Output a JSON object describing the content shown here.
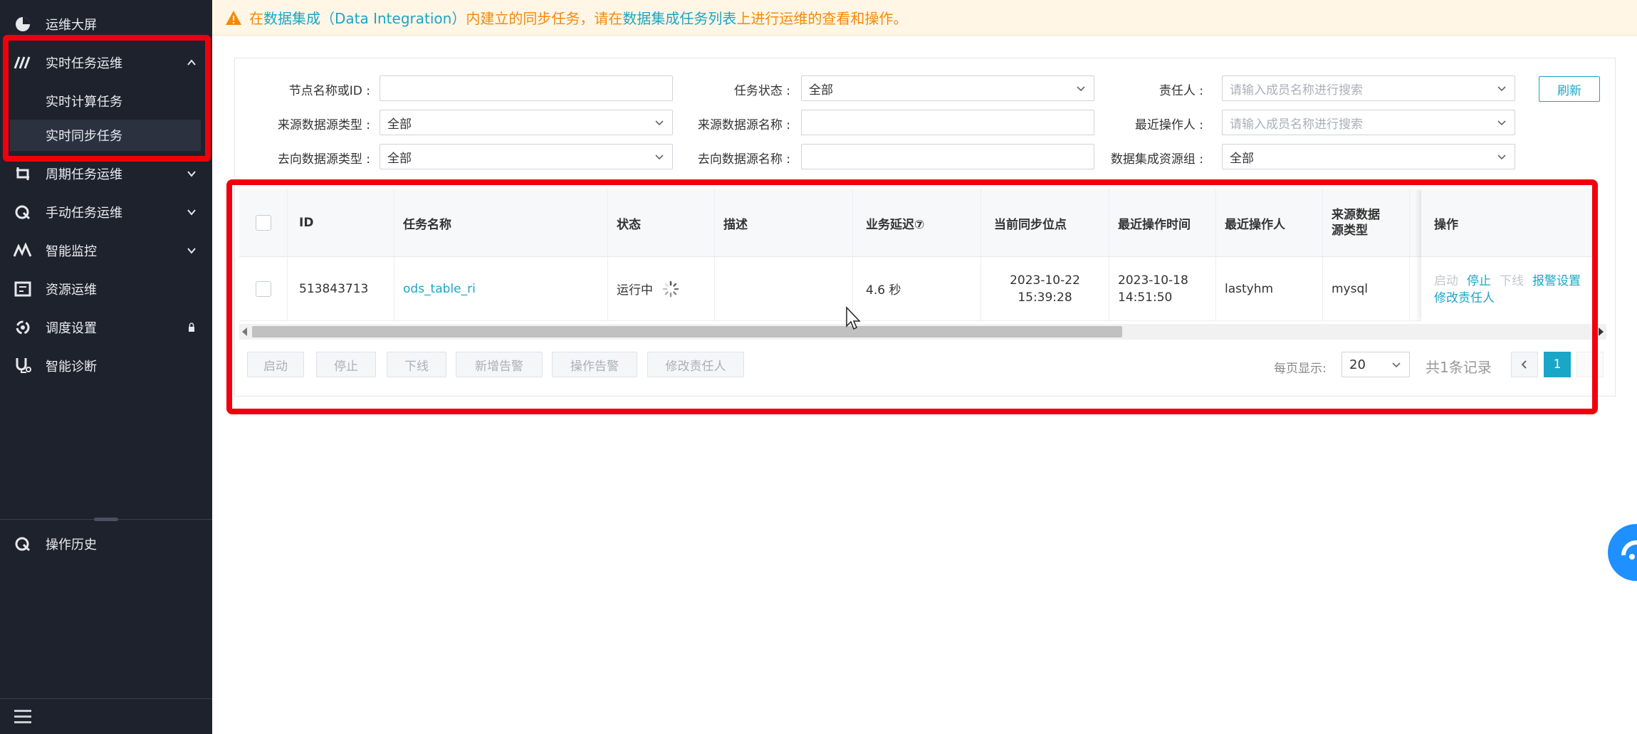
{
  "sidebar": {
    "items": [
      {
        "label": "运维大屏",
        "icon": "pie-chart-icon"
      },
      {
        "label": "实时任务运维",
        "icon": "stream-icon"
      },
      {
        "label": "周期任务运维",
        "icon": "cycle-icon"
      },
      {
        "label": "手动任务运维",
        "icon": "manual-icon"
      },
      {
        "label": "智能监控",
        "icon": "monitor-icon"
      },
      {
        "label": "资源运维",
        "icon": "resource-icon"
      },
      {
        "label": "调度设置",
        "icon": "schedule-icon"
      },
      {
        "label": "智能诊断",
        "icon": "diagnose-icon"
      }
    ],
    "sub_items": [
      {
        "label": "实时计算任务"
      },
      {
        "label": "实时同步任务",
        "active": true
      }
    ],
    "history": {
      "label": "操作历史"
    }
  },
  "banner": {
    "prefix": "在 ",
    "link1": "数据集成（Data Integration）",
    "middle": "内建立的同步任务，请在",
    "link2": "数据集成任务列表",
    "suffix": "上进行运维的查看和操作。"
  },
  "filters": {
    "node_label": "节点名称或ID :",
    "node_value": "",
    "status_label": "任务状态 :",
    "status_value": "全部",
    "owner_label": "责任人 :",
    "owner_placeholder": "请输入成员名称进行搜索",
    "src_type_label": "来源数据源类型 :",
    "src_type_value": "全部",
    "src_name_label": "来源数据源名称 :",
    "src_name_value": "",
    "last_op_label": "最近操作人 :",
    "last_op_placeholder": "请输入成员名称进行搜索",
    "dst_type_label": "去向数据源类型 :",
    "dst_type_value": "全部",
    "dst_name_label": "去向数据源名称 :",
    "dst_name_value": "",
    "res_group_label": "数据集成资源组 :",
    "res_group_value": "全部",
    "refresh_label": "刷新"
  },
  "table": {
    "headers": {
      "id": "ID",
      "name": "任务名称",
      "status": "状态",
      "desc": "描述",
      "delay": "业务延迟⑦",
      "sync_pos": "当前同步位点",
      "last_time": "最近操作时间",
      "last_user": "最近操作人",
      "src_type": "来源数据源类型",
      "ops": "操作"
    },
    "rows": [
      {
        "id": "513843713",
        "name": "ods_table_ri",
        "status": "运行中",
        "desc": "",
        "delay": "4.6 秒",
        "sync_pos": "2023-10-22 15:39:28",
        "last_time": "2023-10-18 14:51:50",
        "last_user": "lastyhm",
        "src_type": "mysql",
        "ops": {
          "start": "启动",
          "stop": "停止",
          "offline": "下线",
          "alarm": "报警设置",
          "owner": "修改责任人"
        }
      }
    ]
  },
  "actions": {
    "start": "启动",
    "stop": "停止",
    "offline": "下线",
    "add_alarm": "新增告警",
    "op_alarm": "操作告警",
    "change_owner": "修改责任人"
  },
  "pagination": {
    "page_size_label": "每页显示:",
    "page_size": "20",
    "total": "共1条记录",
    "current_page": "1"
  },
  "colors": {
    "accent": "#1aa6c7",
    "sidebar_bg": "#1e222d",
    "warning": "#f5890a",
    "highlight_box": "#f0000d"
  }
}
